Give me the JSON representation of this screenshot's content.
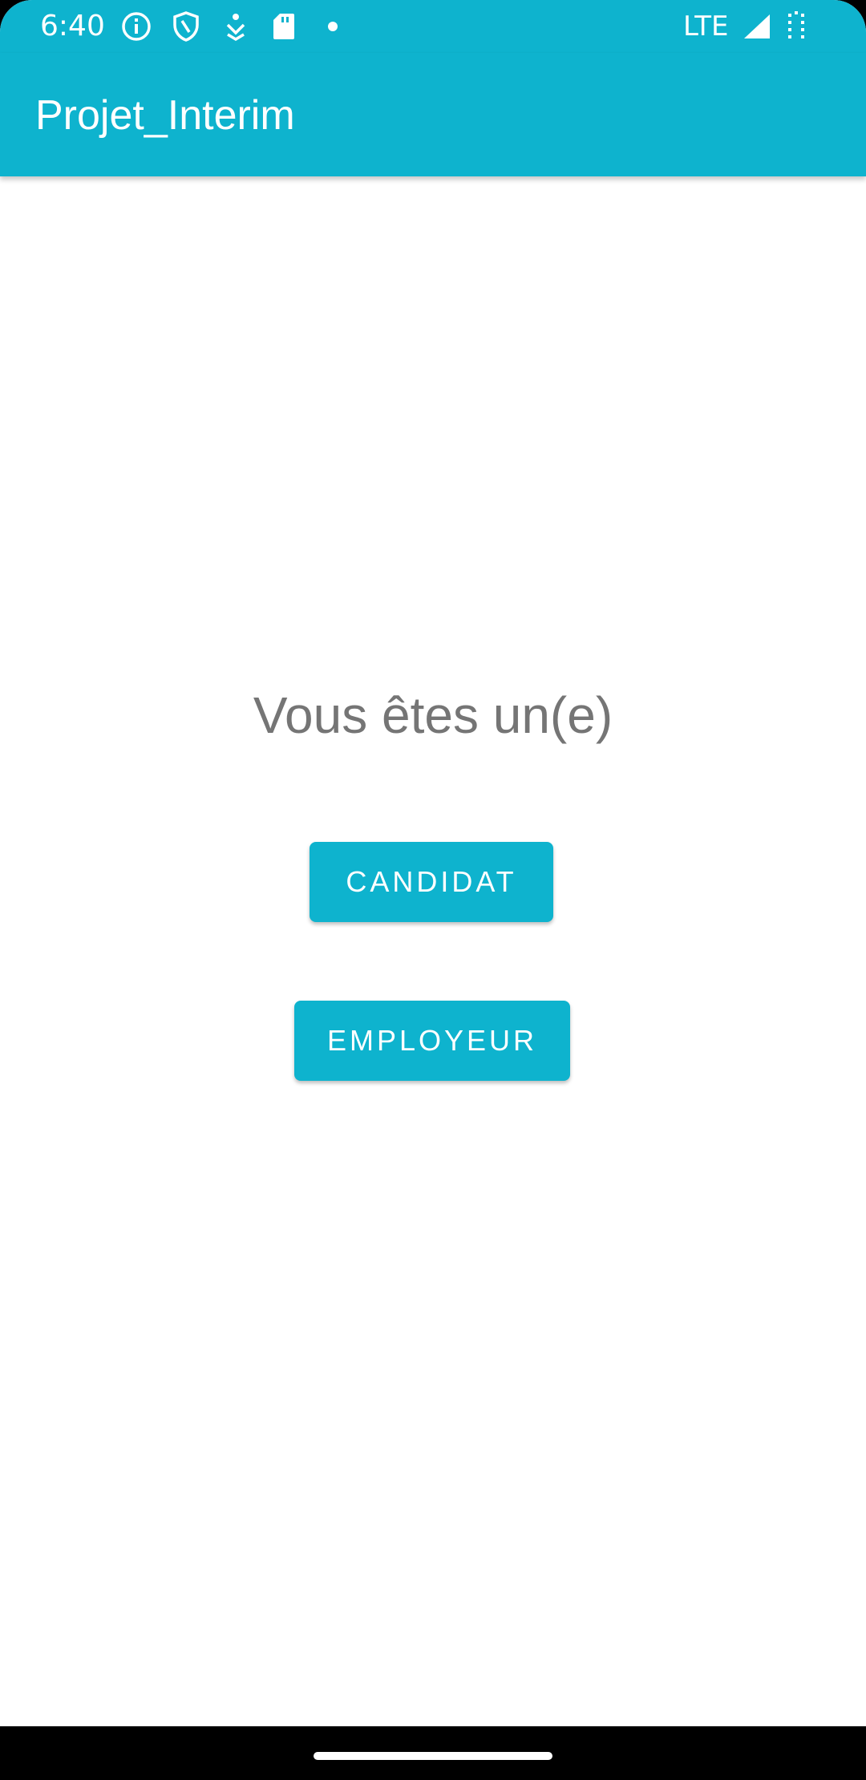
{
  "status_bar": {
    "time": "6:40",
    "network": "LTE",
    "icons": [
      "info-icon",
      "shield-icon",
      "download-icon",
      "sd-card-icon",
      "notification-dot-icon",
      "signal-icon",
      "battery-icon"
    ]
  },
  "app_bar": {
    "title": "Projet_Interim"
  },
  "main": {
    "prompt": "Vous êtes un(e)",
    "candidat_label": "CANDIDAT",
    "employeur_label": "EMPLOYEUR"
  },
  "colors": {
    "accent": "#0EB3CE",
    "prompt_text": "#757575",
    "background": "#FFFFFF"
  }
}
